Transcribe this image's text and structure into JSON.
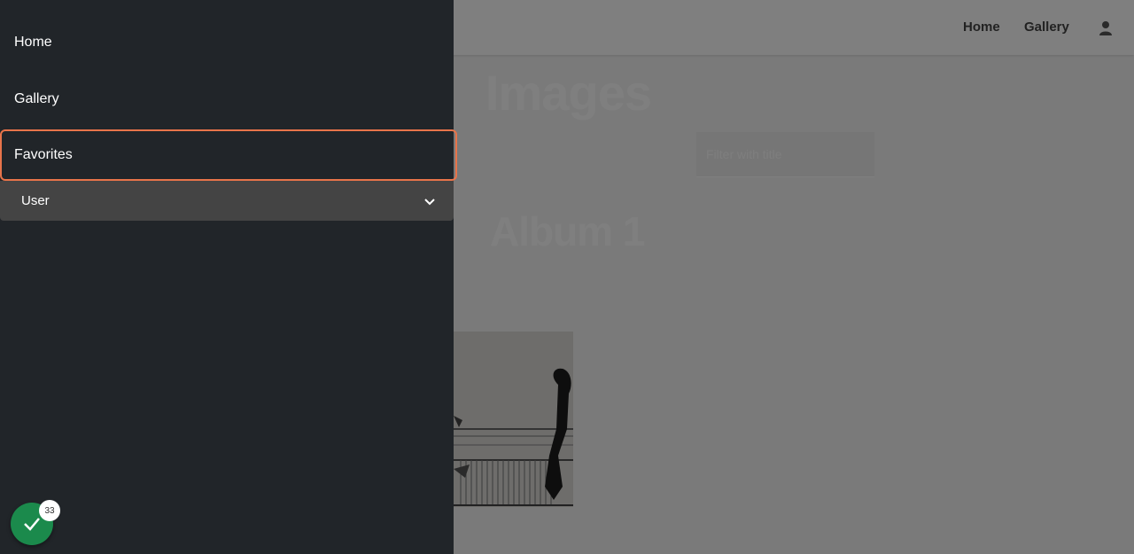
{
  "topbar": {
    "home_label": "Home",
    "gallery_label": "Gallery",
    "user_icon": "user-icon"
  },
  "main": {
    "title": "Images",
    "filter_placeholder": "Filter with title",
    "album_title": "Album 1"
  },
  "drawer": {
    "items": [
      {
        "label": "Home"
      },
      {
        "label": "Gallery"
      },
      {
        "label": "Favorites"
      }
    ],
    "user_section_label": "User",
    "chevron_icon": "chevron-down-icon"
  },
  "status_badge": {
    "icon": "check-icon",
    "count": "33"
  },
  "colors": {
    "drawer_bg": "#212529",
    "focus_outline": "#e8744a",
    "badge_green": "#1b8a4c"
  }
}
